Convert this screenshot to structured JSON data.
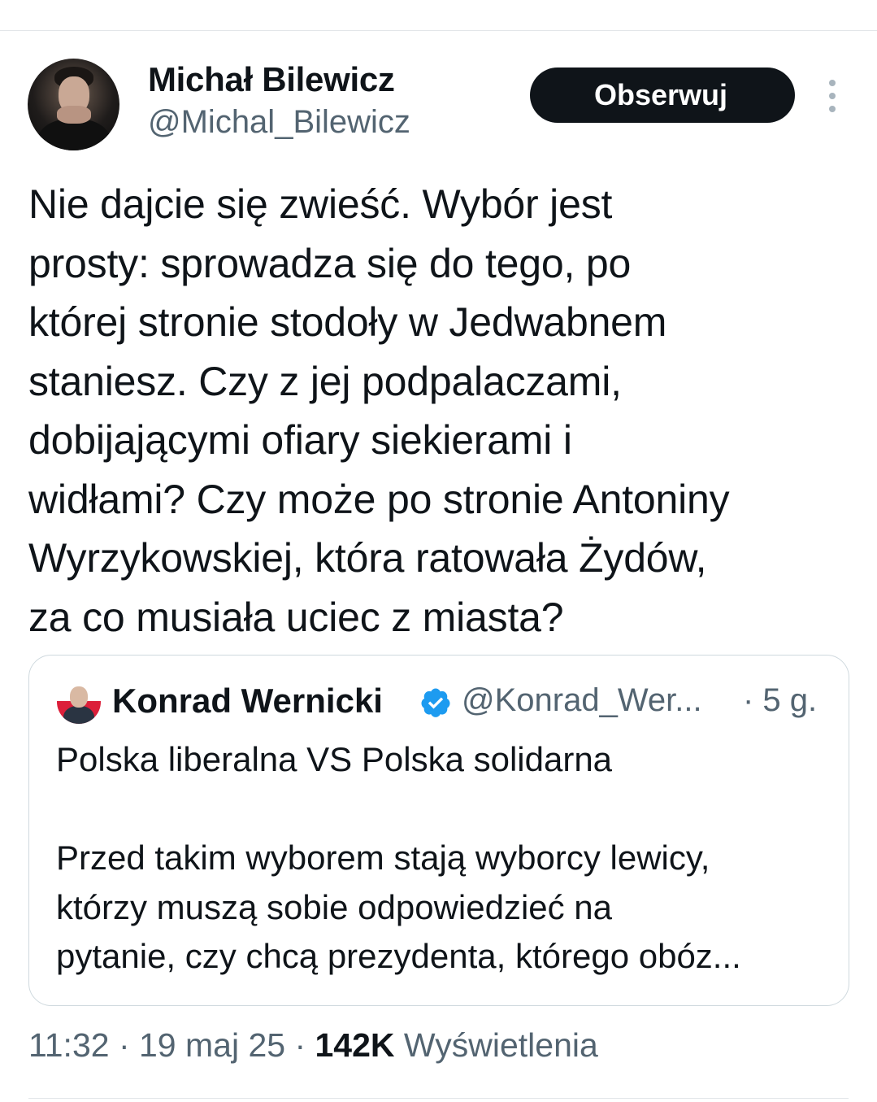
{
  "author": {
    "name": "Michał Bilewicz",
    "handle": "@Michal_Bilewicz"
  },
  "actions": {
    "follow_label": "Obserwuj",
    "more_icon": "more-vertical-icon"
  },
  "tweet": {
    "text": "Nie dajcie się zwieść. Wybór jest\nprosty: sprowadza się do tego, po\nktórej stronie stodoły w Jedwabnem\nstaniesz. Czy z jej podpalaczami,\ndobijającymi ofiary siekierami i\nwidłami? Czy może po stronie Antoniny\nWyrzykowskiej, która ratowała Żydów,\nza co musiała uciec z miasta?"
  },
  "quoted": {
    "name": "Konrad Wernicki",
    "verified_icon": "verified-badge-icon",
    "verified_color": "#1d9bf0",
    "handle": "@Konrad_Wer...",
    "time": "· 5 g.",
    "text": "Polska liberalna VS Polska solidarna\n\nPrzed takim wyborem stają wyborcy lewicy,\nktórzy muszą sobie odpowiedzieć na\npytanie, czy chcą prezydenta, którego obóz..."
  },
  "meta": {
    "time": "11:32",
    "sep1": " · ",
    "date": "19 maj 25",
    "sep2": " · ",
    "views_count": "142K",
    "views_label": " Wyświetlenia"
  }
}
